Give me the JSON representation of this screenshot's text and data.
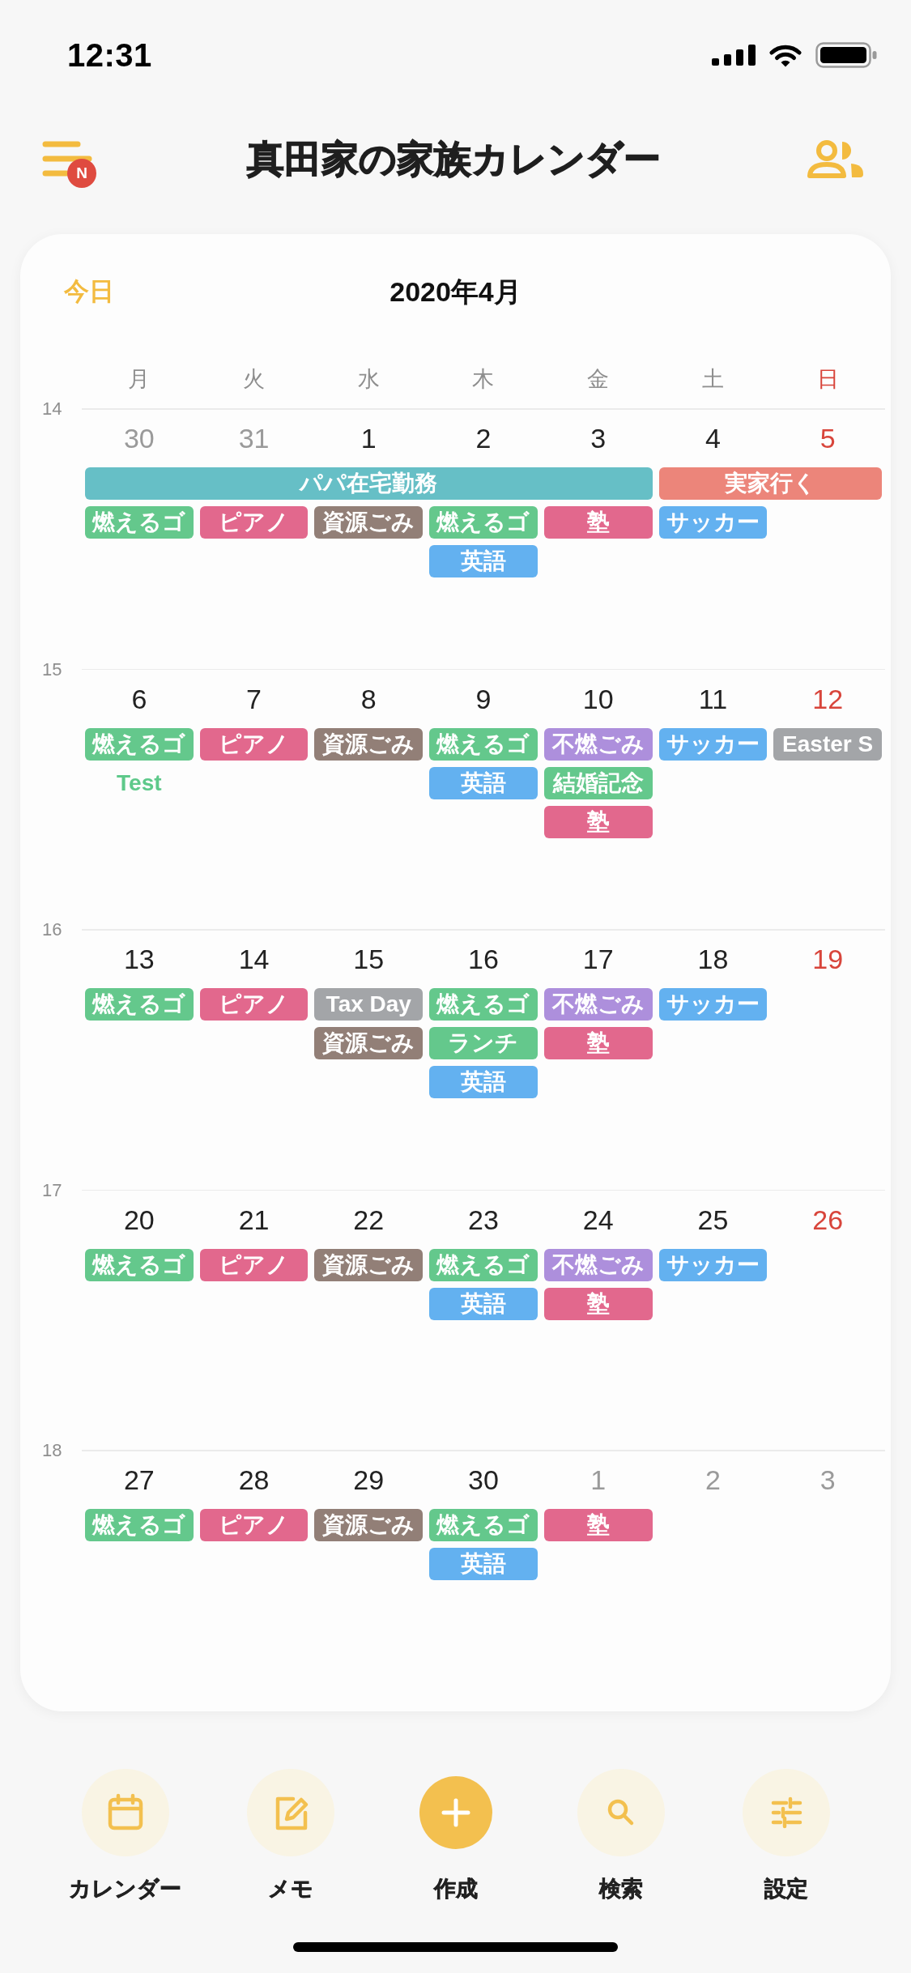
{
  "status_bar": {
    "time": "12:31"
  },
  "header": {
    "menu_badge": "N",
    "title": "真田家の家族カレンダー"
  },
  "calendar": {
    "today_button": "今日",
    "month": "2020年4月",
    "weekdays": [
      {
        "label": "月",
        "sunday": false
      },
      {
        "label": "火",
        "sunday": false
      },
      {
        "label": "水",
        "sunday": false
      },
      {
        "label": "木",
        "sunday": false
      },
      {
        "label": "金",
        "sunday": false
      },
      {
        "label": "土",
        "sunday": false
      },
      {
        "label": "日",
        "sunday": true
      }
    ],
    "weeks": [
      {
        "number": "14",
        "days": [
          {
            "date": "30",
            "kind": "outside",
            "events": [
              {
                "kind": "banner",
                "title": "パパ在宅勤務",
                "color": "#66bfc6"
              },
              {
                "kind": "bar",
                "title": "燃えるゴ",
                "color": "#64c88c"
              }
            ]
          },
          {
            "date": "31",
            "kind": "outside",
            "events": [
              {
                "kind": "continued"
              },
              {
                "kind": "bar",
                "title": "ピアノ",
                "color": "#e2688d"
              }
            ]
          },
          {
            "date": "1",
            "kind": "weekday",
            "events": [
              {
                "kind": "continued"
              },
              {
                "kind": "bar",
                "title": "資源ごみ",
                "color": "#927f77"
              }
            ]
          },
          {
            "date": "2",
            "kind": "weekday",
            "events": [
              {
                "kind": "continued"
              },
              {
                "kind": "bar",
                "title": "燃えるゴ",
                "color": "#64c88c"
              },
              {
                "kind": "bar",
                "title": "英語",
                "color": "#63b1f0"
              }
            ]
          },
          {
            "date": "3",
            "kind": "weekday",
            "events": [
              {
                "kind": "continued"
              },
              {
                "kind": "bar",
                "title": "塾",
                "color": "#e2688d"
              }
            ]
          },
          {
            "date": "4",
            "kind": "weekday",
            "events": [
              {
                "kind": "banner",
                "title": "実家行く",
                "color": "#ec857a"
              },
              {
                "kind": "bar",
                "title": "サッカー",
                "color": "#63b1f0"
              }
            ]
          },
          {
            "date": "5",
            "kind": "sunday",
            "events": [
              {
                "kind": "continued"
              }
            ]
          }
        ]
      },
      {
        "number": "15",
        "days": [
          {
            "date": "6",
            "kind": "weekday",
            "events": [
              {
                "kind": "bar",
                "title": "燃えるゴ",
                "color": "#64c88c"
              },
              {
                "kind": "text",
                "title": "Test",
                "color": "#5ec98a"
              }
            ]
          },
          {
            "date": "7",
            "kind": "weekday",
            "events": [
              {
                "kind": "bar",
                "title": "ピアノ",
                "color": "#e2688d"
              }
            ]
          },
          {
            "date": "8",
            "kind": "weekday",
            "events": [
              {
                "kind": "bar",
                "title": "資源ごみ",
                "color": "#927f77"
              }
            ]
          },
          {
            "date": "9",
            "kind": "weekday",
            "events": [
              {
                "kind": "bar",
                "title": "燃えるゴ",
                "color": "#64c88c"
              },
              {
                "kind": "bar",
                "title": "英語",
                "color": "#63b1f0"
              }
            ]
          },
          {
            "date": "10",
            "kind": "weekday",
            "events": [
              {
                "kind": "bar",
                "title": "不燃ごみ",
                "color": "#ad8fdc"
              },
              {
                "kind": "bar",
                "title": "結婚記念",
                "color": "#64c88c"
              },
              {
                "kind": "bar",
                "title": "塾",
                "color": "#e2688d"
              }
            ]
          },
          {
            "date": "11",
            "kind": "weekday",
            "events": [
              {
                "kind": "bar",
                "title": "サッカー",
                "color": "#63b1f0"
              }
            ]
          },
          {
            "date": "12",
            "kind": "sunday",
            "events": [
              {
                "kind": "bar",
                "title": "Easter S",
                "color": "#a3a5a8"
              }
            ]
          }
        ]
      },
      {
        "number": "16",
        "days": [
          {
            "date": "13",
            "kind": "weekday",
            "events": [
              {
                "kind": "bar",
                "title": "燃えるゴ",
                "color": "#64c88c"
              }
            ]
          },
          {
            "date": "14",
            "kind": "weekday",
            "events": [
              {
                "kind": "bar",
                "title": "ピアノ",
                "color": "#e2688d"
              }
            ]
          },
          {
            "date": "15",
            "kind": "weekday",
            "events": [
              {
                "kind": "bar",
                "title": "Tax Day",
                "color": "#a3a5a8"
              },
              {
                "kind": "bar",
                "title": "資源ごみ",
                "color": "#927f77"
              }
            ]
          },
          {
            "date": "16",
            "kind": "weekday",
            "events": [
              {
                "kind": "bar",
                "title": "燃えるゴ",
                "color": "#64c88c"
              },
              {
                "kind": "bar",
                "title": "ランチ",
                "color": "#64c88c"
              },
              {
                "kind": "bar",
                "title": "英語",
                "color": "#63b1f0"
              }
            ]
          },
          {
            "date": "17",
            "kind": "weekday",
            "events": [
              {
                "kind": "bar",
                "title": "不燃ごみ",
                "color": "#ad8fdc"
              },
              {
                "kind": "bar",
                "title": "塾",
                "color": "#e2688d"
              }
            ]
          },
          {
            "date": "18",
            "kind": "weekday",
            "events": [
              {
                "kind": "bar",
                "title": "サッカー",
                "color": "#63b1f0"
              }
            ]
          },
          {
            "date": "19",
            "kind": "sunday"
          }
        ]
      },
      {
        "number": "17",
        "days": [
          {
            "date": "20",
            "kind": "weekday",
            "events": [
              {
                "kind": "bar",
                "title": "燃えるゴ",
                "color": "#64c88c"
              }
            ]
          },
          {
            "date": "21",
            "kind": "weekday",
            "events": [
              {
                "kind": "bar",
                "title": "ピアノ",
                "color": "#e2688d"
              }
            ]
          },
          {
            "date": "22",
            "kind": "weekday",
            "events": [
              {
                "kind": "bar",
                "title": "資源ごみ",
                "color": "#927f77"
              }
            ]
          },
          {
            "date": "23",
            "kind": "weekday",
            "events": [
              {
                "kind": "bar",
                "title": "燃えるゴ",
                "color": "#64c88c"
              },
              {
                "kind": "bar",
                "title": "英語",
                "color": "#63b1f0"
              }
            ]
          },
          {
            "date": "24",
            "kind": "weekday",
            "events": [
              {
                "kind": "bar",
                "title": "不燃ごみ",
                "color": "#ad8fdc"
              },
              {
                "kind": "bar",
                "title": "塾",
                "color": "#e2688d"
              }
            ]
          },
          {
            "date": "25",
            "kind": "weekday",
            "events": [
              {
                "kind": "bar",
                "title": "サッカー",
                "color": "#63b1f0"
              }
            ]
          },
          {
            "date": "26",
            "kind": "sunday"
          }
        ]
      },
      {
        "number": "18",
        "days": [
          {
            "date": "27",
            "kind": "weekday",
            "events": [
              {
                "kind": "bar",
                "title": "燃えるゴ",
                "color": "#64c88c"
              }
            ]
          },
          {
            "date": "28",
            "kind": "weekday",
            "events": [
              {
                "kind": "bar",
                "title": "ピアノ",
                "color": "#e2688d"
              }
            ]
          },
          {
            "date": "29",
            "kind": "weekday",
            "events": [
              {
                "kind": "bar",
                "title": "資源ごみ",
                "color": "#927f77"
              }
            ]
          },
          {
            "date": "30",
            "kind": "weekday",
            "events": [
              {
                "kind": "bar",
                "title": "燃えるゴ",
                "color": "#64c88c"
              },
              {
                "kind": "bar",
                "title": "英語",
                "color": "#63b1f0"
              }
            ]
          },
          {
            "date": "1",
            "kind": "outside",
            "events": [
              {
                "kind": "bar",
                "title": "塾",
                "color": "#e2688d"
              }
            ]
          },
          {
            "date": "2",
            "kind": "outside"
          },
          {
            "date": "3",
            "kind": "outside"
          }
        ]
      }
    ]
  },
  "nav": [
    {
      "kind": "tab",
      "label": "カレンダー"
    },
    {
      "kind": "tab",
      "label": "メモ"
    },
    {
      "kind": "primary",
      "label": "作成"
    },
    {
      "kind": "tab",
      "label": "検索"
    },
    {
      "kind": "tab",
      "label": "設定"
    }
  ]
}
